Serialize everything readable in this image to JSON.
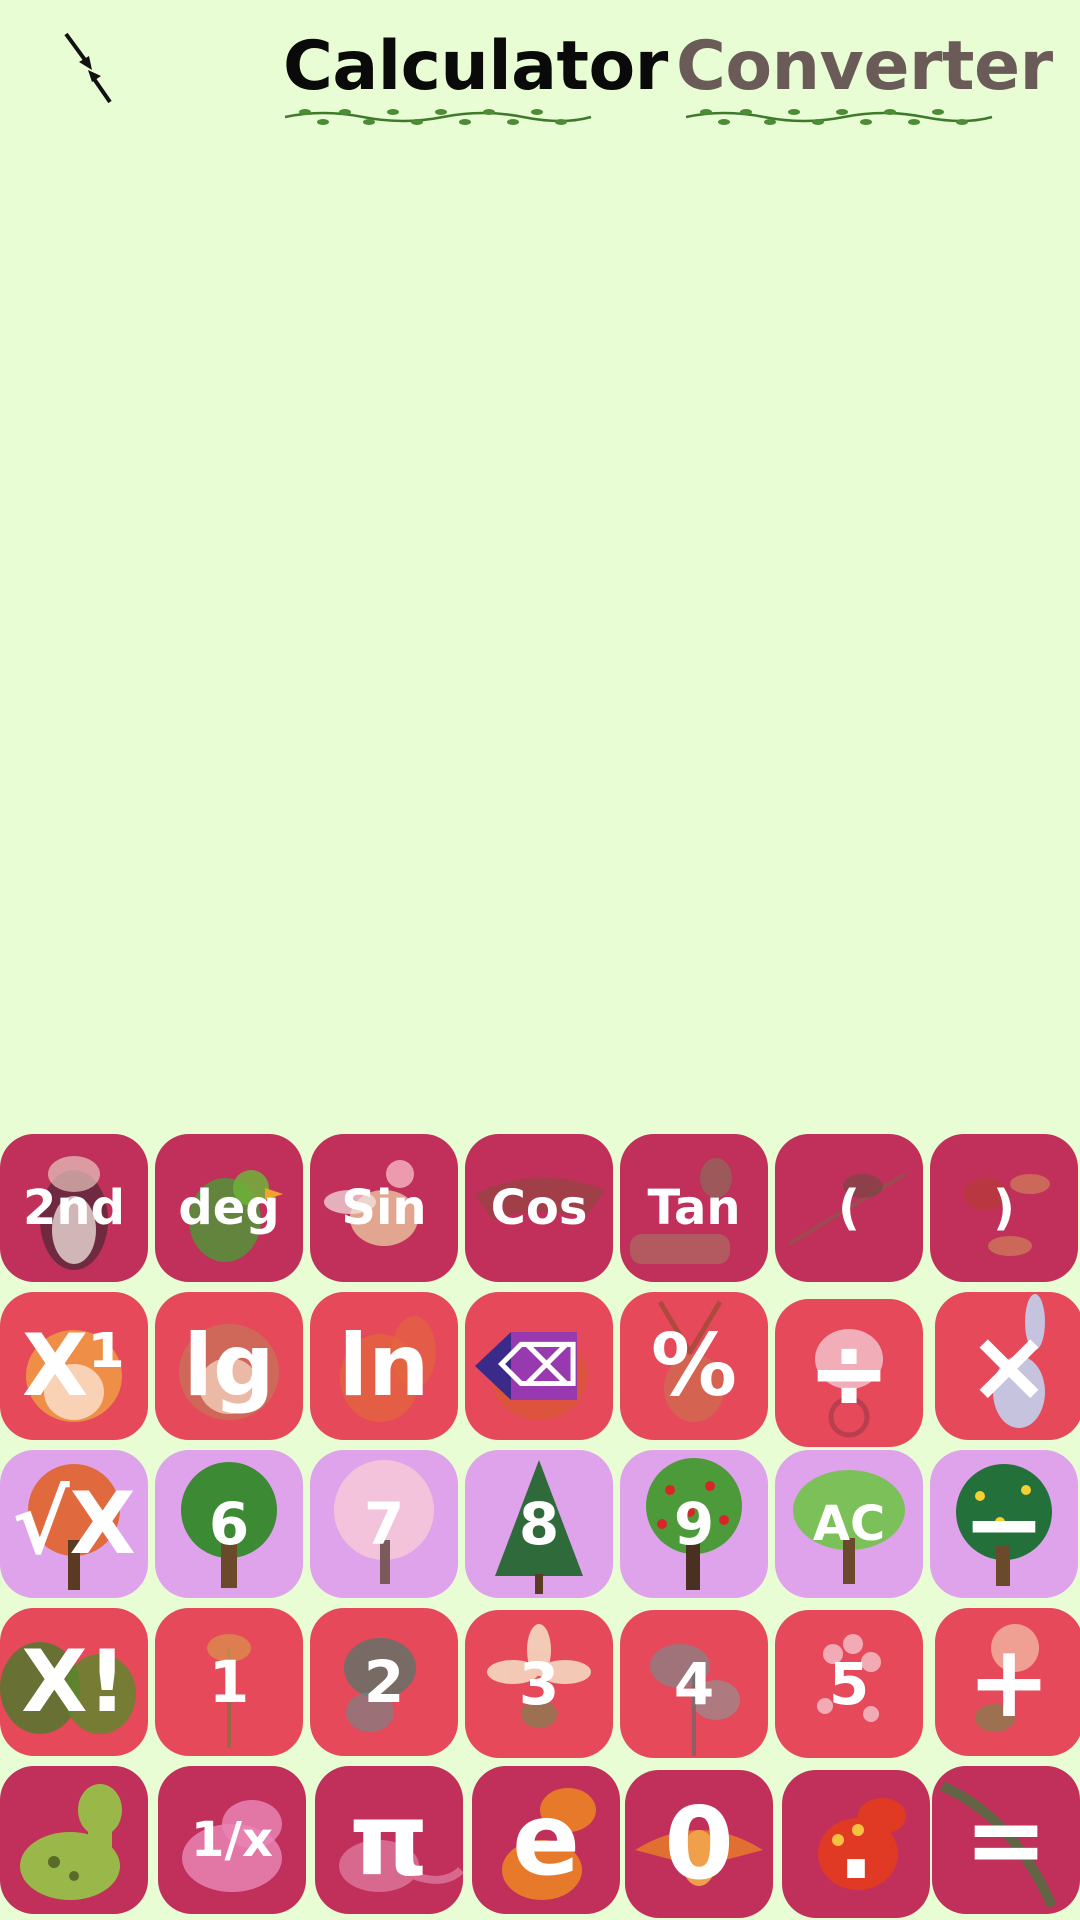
{
  "header": {
    "collapse_icon": "collapse-arrows-icon",
    "tabs": [
      {
        "label": "Calculator",
        "active": true
      },
      {
        "label": "Converter",
        "active": false
      }
    ]
  },
  "display": {
    "expression": "",
    "result": ""
  },
  "colors": {
    "background": "#e9fdd5",
    "key_crimson": "#c0305a",
    "key_red": "#e5495a",
    "key_lilac": "#dea3ea",
    "tab_active": "#0a0a0a",
    "tab_inactive": "#6b5b58"
  },
  "keypad": {
    "row1": [
      "2nd",
      "deg",
      "Sin",
      "Cos",
      "Tan",
      "(",
      ")"
    ],
    "row2": [
      "X¹",
      "lg",
      "ln",
      "⌫",
      "%",
      "÷",
      "×"
    ],
    "row3": [
      "√X",
      "6",
      "7",
      "8",
      "9",
      "AC",
      "−"
    ],
    "row4": [
      "X!",
      "1",
      "2",
      "3",
      "4",
      "5",
      "+"
    ],
    "row5": [
      "",
      "1/x",
      "π",
      "e",
      "0",
      ".",
      "="
    ]
  }
}
